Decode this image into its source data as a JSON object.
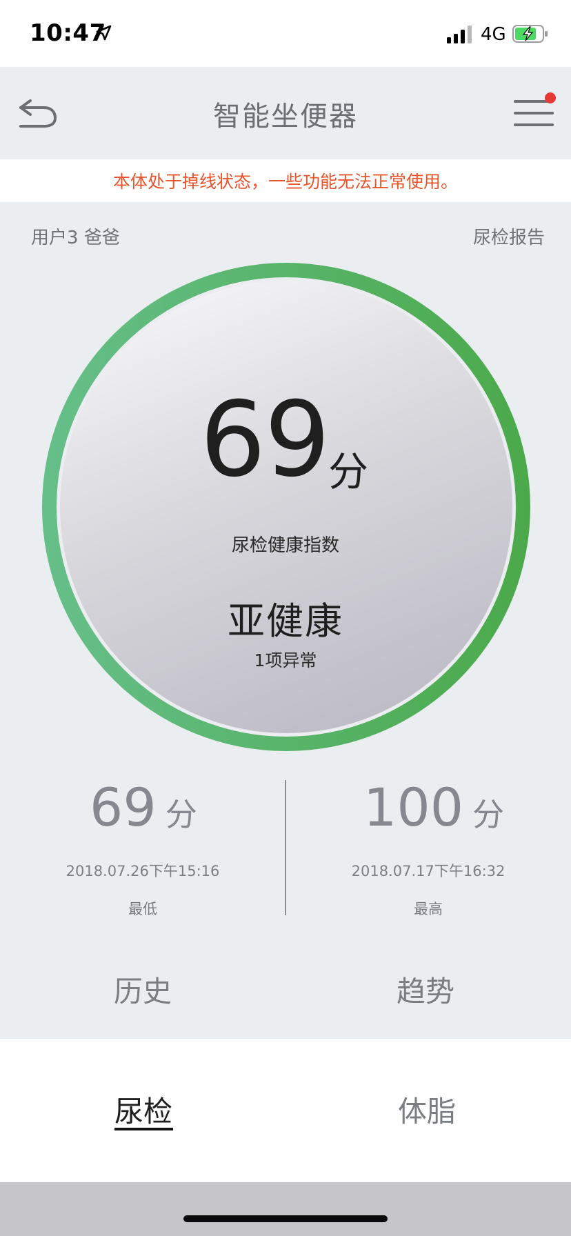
{
  "status_bar": {
    "time": "10:47",
    "network": "4G",
    "icons": [
      "location-arrow-icon",
      "signal-bars-icon",
      "battery-charging-icon"
    ]
  },
  "nav": {
    "title": "智能坐便器",
    "back_icon": "back-arrow-icon",
    "menu_icon": "hamburger-menu-icon",
    "notification_color": "#e53935"
  },
  "warning": {
    "text": "本体处于掉线状态，一些功能无法正常使用。",
    "color": "#e8542b"
  },
  "user": {
    "label": "用户3 爸爸",
    "report_link": "尿检报告"
  },
  "gauge": {
    "score": "69",
    "unit": "分",
    "index_label": "尿检健康指数",
    "status": "亚健康",
    "abnormal": "1项异常",
    "ring_colors": [
      "#5fba84",
      "#4cab4a"
    ]
  },
  "stats": {
    "min": {
      "value": "69",
      "unit": "分",
      "date": "2018.07.26下午15:16",
      "caption": "最低"
    },
    "max": {
      "value": "100",
      "unit": "分",
      "date": "2018.07.17下午16:32",
      "caption": "最高"
    }
  },
  "actions": {
    "history": "历史",
    "trend": "趋势"
  },
  "tabs": {
    "urine": "尿检",
    "bodyfat": "体脂",
    "active": "尿检"
  }
}
